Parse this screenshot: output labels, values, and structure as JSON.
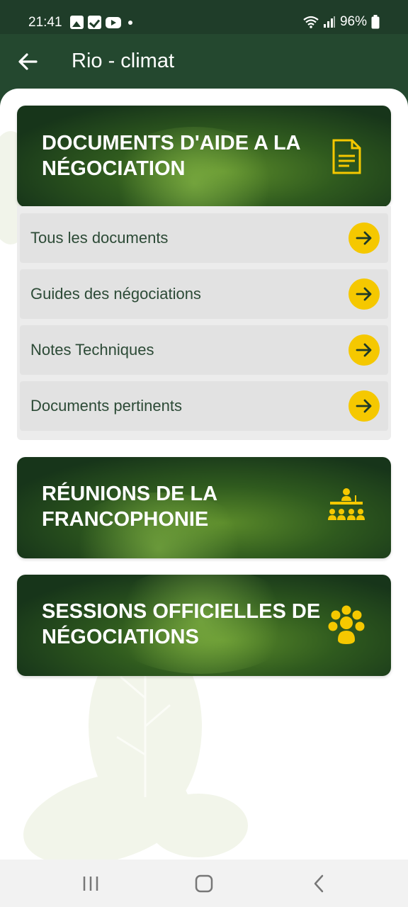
{
  "status_bar": {
    "time": "21:41",
    "battery": "96%",
    "left_icons": [
      "gallery-icon",
      "check-icon",
      "youtube-icon",
      "dot-icon"
    ],
    "right_icons": [
      "wifi-icon",
      "signal-icon",
      "battery-icon"
    ]
  },
  "app_bar": {
    "title": "Rio - climat",
    "back_icon": "arrow-left-icon"
  },
  "colors": {
    "header": "#24482f",
    "accent": "#f5c800",
    "label_text": "#2c4a36"
  },
  "sections": [
    {
      "title_line1": "DOCUMENTS D'AIDE A LA",
      "title_line2": "NÉGOCIATION",
      "icon": "document-icon",
      "expanded": true,
      "items": [
        {
          "label": "Tous les documents",
          "icon": "arrow-right-icon"
        },
        {
          "label": "Guides des négociations",
          "icon": "arrow-right-icon"
        },
        {
          "label": "Notes Techniques",
          "icon": "arrow-right-icon"
        },
        {
          "label": "Documents pertinents",
          "icon": "arrow-right-icon"
        }
      ]
    },
    {
      "title_line1": "RÉUNIONS DE LA",
      "title_line2": "FRANCOPHONIE",
      "icon": "meeting-icon",
      "expanded": false
    },
    {
      "title_line1": "SESSIONS OFFICIELLES DE",
      "title_line2": "NÉGOCIATIONS",
      "icon": "group-icon",
      "expanded": false
    }
  ],
  "nav_bar": {
    "buttons": [
      "recent-apps-icon",
      "home-icon",
      "back-icon"
    ]
  }
}
